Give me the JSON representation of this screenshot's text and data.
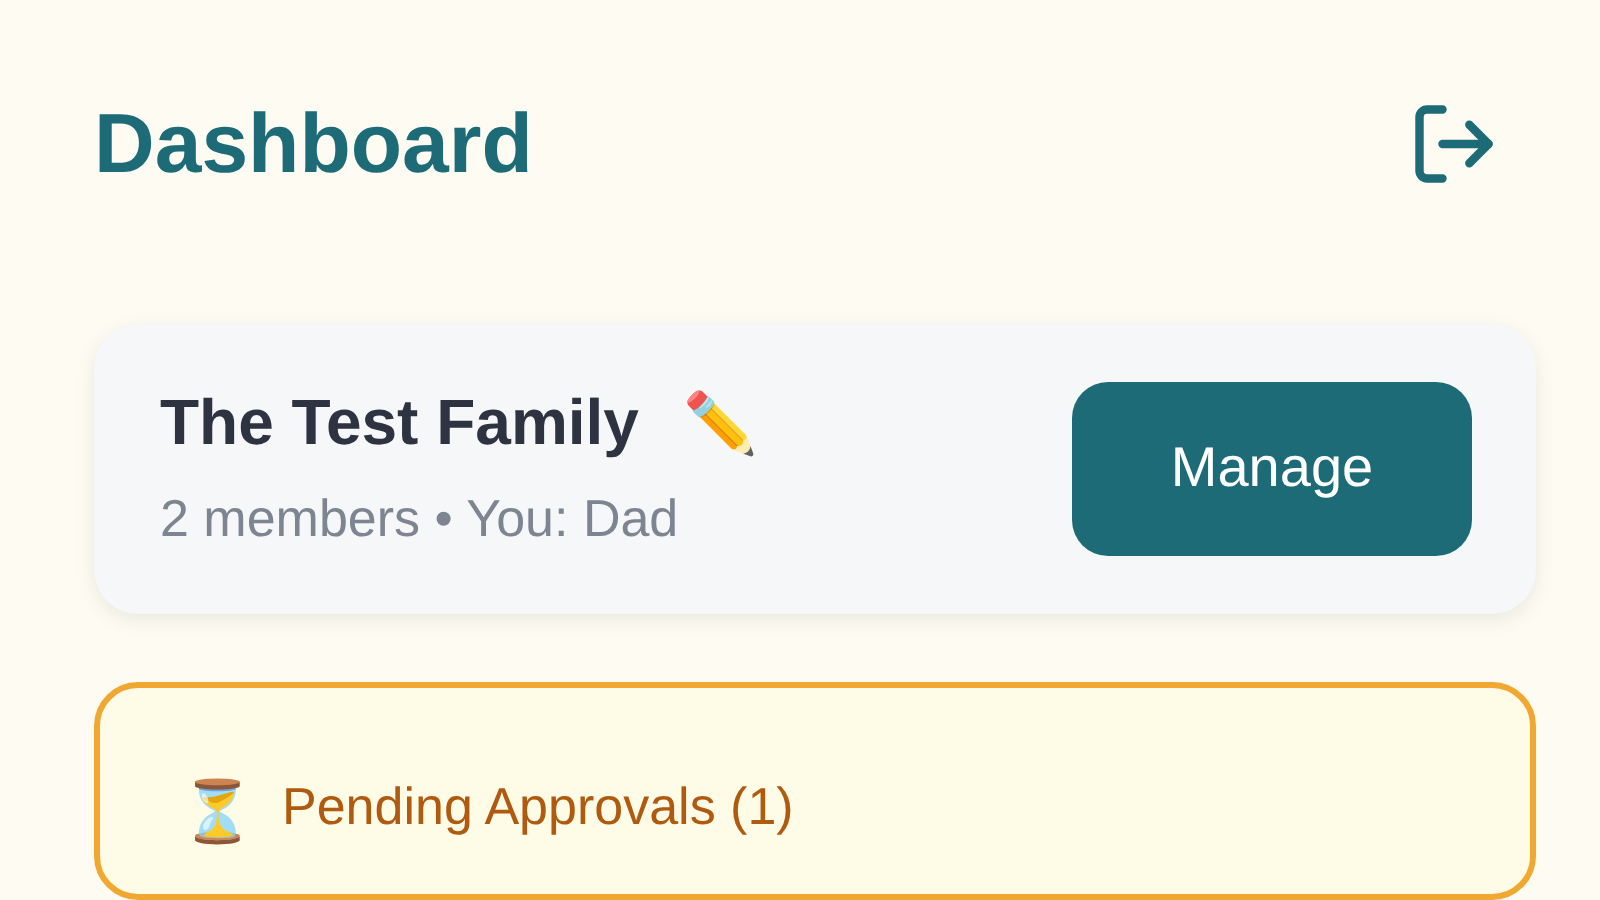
{
  "header": {
    "title": "Dashboard"
  },
  "family_card": {
    "name": "The Test Family",
    "edit_emoji": "✏️",
    "subtitle": "2 members • You: Dad",
    "button": "Manage"
  },
  "pending_card": {
    "emoji": "⏳",
    "title": "Pending Approvals (1)"
  }
}
